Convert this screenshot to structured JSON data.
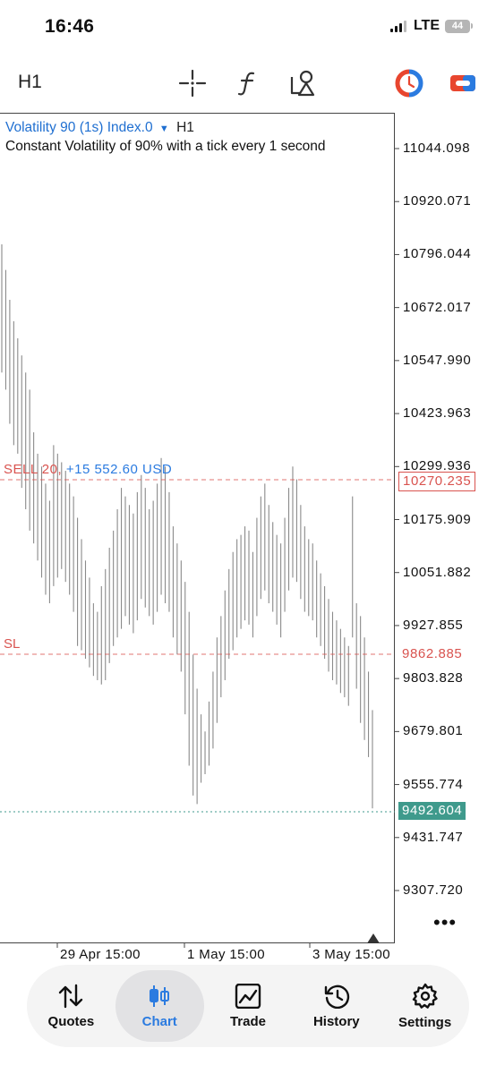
{
  "status_bar": {
    "time": "16:46",
    "network": "LTE",
    "battery": "44"
  },
  "toolbar": {
    "timeframe": "H1",
    "tools": [
      "crosshair-icon",
      "function-icon",
      "objects-icon"
    ],
    "right_icons": [
      "one-click-trading-icon",
      "account-toggle-icon"
    ]
  },
  "chart": {
    "symbol": "Volatility 90 (1s) Index.0",
    "symbol_timeframe": "H1",
    "description": "Constant Volatility of 90% with a tick every 1 second",
    "y_ticks": [
      "11044.098",
      "10920.071",
      "10796.044",
      "10672.017",
      "10547.990",
      "10423.963",
      "10299.936",
      "10175.909",
      "10051.882",
      "9927.855",
      "9803.828",
      "9679.801",
      "9555.774",
      "9431.747",
      "9307.720"
    ],
    "x_ticks": [
      "29 Apr 15:00",
      "1 May 15:00",
      "3 May 15:00"
    ],
    "trade_line": {
      "label": "SELL 20,",
      "pnl": "+15 552.60 USD",
      "price": "10270.235",
      "color": "#d9534f"
    },
    "sl_line": {
      "label": "SL",
      "price": "9862.885",
      "color": "#d9534f"
    },
    "bid": {
      "price": "9492.604",
      "color": "#3f9a8c"
    }
  },
  "chart_data": {
    "type": "ohlc",
    "ylim": [
      9246,
      11080
    ],
    "x_labels": [
      "29 Apr 15:00",
      "1 May 15:00",
      "3 May 15:00"
    ],
    "bars_approx_high_low": [
      [
        10820,
        10520
      ],
      [
        10760,
        10480
      ],
      [
        10690,
        10400
      ],
      [
        10640,
        10350
      ],
      [
        10600,
        10330
      ],
      [
        10560,
        10250
      ],
      [
        10520,
        10200
      ],
      [
        10480,
        10150
      ],
      [
        10380,
        10120
      ],
      [
        10330,
        10080
      ],
      [
        10300,
        10040
      ],
      [
        10260,
        10000
      ],
      [
        10220,
        9980
      ],
      [
        10350,
        10020
      ],
      [
        10330,
        10040
      ],
      [
        10310,
        10060
      ],
      [
        10290,
        10030
      ],
      [
        10260,
        10000
      ],
      [
        10230,
        9960
      ],
      [
        10180,
        9880
      ],
      [
        10130,
        9870
      ],
      [
        10080,
        9850
      ],
      [
        10040,
        9830
      ],
      [
        9980,
        9810
      ],
      [
        9960,
        9800
      ],
      [
        10020,
        9790
      ],
      [
        10060,
        9800
      ],
      [
        10110,
        9840
      ],
      [
        10150,
        9880
      ],
      [
        10200,
        9900
      ],
      [
        10250,
        9920
      ],
      [
        10230,
        9950
      ],
      [
        10210,
        9930
      ],
      [
        10190,
        9910
      ],
      [
        10240,
        9940
      ],
      [
        10280,
        9990
      ],
      [
        10250,
        9970
      ],
      [
        10200,
        9950
      ],
      [
        10220,
        9930
      ],
      [
        10260,
        9960
      ],
      [
        10320,
        10000
      ],
      [
        10300,
        9980
      ],
      [
        10240,
        9960
      ],
      [
        10160,
        9900
      ],
      [
        10120,
        9860
      ],
      [
        10080,
        9820
      ],
      [
        10030,
        9720
      ],
      [
        9960,
        9600
      ],
      [
        9860,
        9530
      ],
      [
        9780,
        9510
      ],
      [
        9720,
        9560
      ],
      [
        9680,
        9580
      ],
      [
        9750,
        9600
      ],
      [
        9820,
        9640
      ],
      [
        9900,
        9700
      ],
      [
        9950,
        9760
      ],
      [
        10010,
        9800
      ],
      [
        10060,
        9850
      ],
      [
        10100,
        9870
      ],
      [
        10130,
        9900
      ],
      [
        10140,
        9920
      ],
      [
        10160,
        9940
      ],
      [
        10150,
        9930
      ],
      [
        10100,
        9900
      ],
      [
        10180,
        9950
      ],
      [
        10230,
        9990
      ],
      [
        10260,
        10010
      ],
      [
        10210,
        9980
      ],
      [
        10170,
        9960
      ],
      [
        10140,
        9930
      ],
      [
        10120,
        9900
      ],
      [
        10180,
        9960
      ],
      [
        10250,
        10010
      ],
      [
        10300,
        10040
      ],
      [
        10270,
        10030
      ],
      [
        10210,
        9990
      ],
      [
        10160,
        9960
      ],
      [
        10130,
        9950
      ],
      [
        10120,
        9940
      ],
      [
        10080,
        9900
      ],
      [
        10050,
        9880
      ],
      [
        10020,
        9850
      ],
      [
        9990,
        9820
      ],
      [
        9960,
        9800
      ],
      [
        9940,
        9790
      ],
      [
        9920,
        9770
      ],
      [
        9900,
        9760
      ],
      [
        9880,
        9740
      ],
      [
        10230,
        9900
      ],
      [
        9980,
        9780
      ],
      [
        9950,
        9700
      ],
      [
        9900,
        9660
      ],
      [
        9820,
        9620
      ],
      [
        9730,
        9500
      ]
    ],
    "open_price": 10270.235,
    "sl_price": 9862.885,
    "bid_price": 9492.604
  },
  "bottom_nav": {
    "items": [
      {
        "label": "Quotes",
        "icon": "quotes-icon"
      },
      {
        "label": "Chart",
        "icon": "chart-icon",
        "active": true
      },
      {
        "label": "Trade",
        "icon": "trade-icon"
      },
      {
        "label": "History",
        "icon": "history-icon"
      },
      {
        "label": "Settings",
        "icon": "settings-icon"
      }
    ],
    "active_color": "#2b7be0"
  }
}
